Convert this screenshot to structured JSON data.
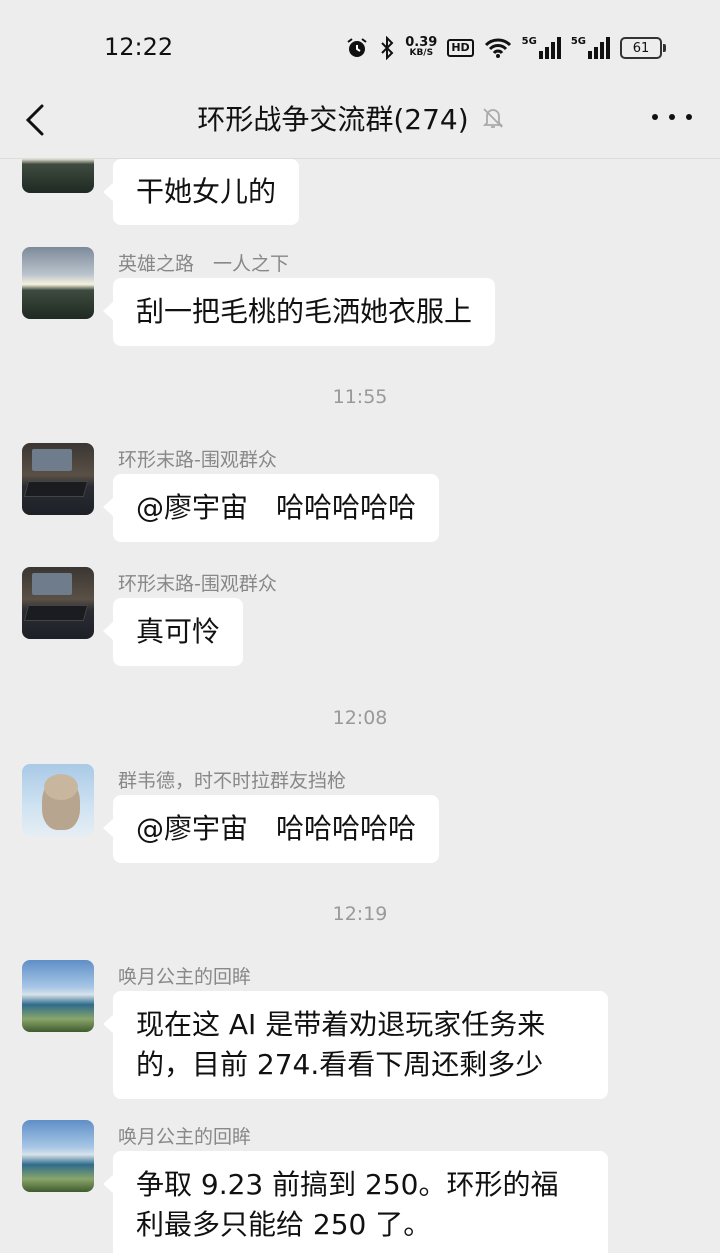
{
  "status_bar": {
    "time": "12:22",
    "net_speed_value": "0.39",
    "net_speed_unit": "KB/S",
    "hd": "HD",
    "sim1": "5G",
    "sim2": "5G",
    "battery": "61",
    "icons": [
      "alarm-icon",
      "bluetooth-icon",
      "hd-icon",
      "wifi-icon",
      "signal-icon",
      "signal-icon",
      "battery-icon"
    ]
  },
  "header": {
    "title": "环形战争交流群(274)",
    "back_icon": "chevron-left-icon",
    "mute_icon": "muted-bell-icon",
    "more_icon": "more-icon"
  },
  "messages": [
    {
      "sender": "",
      "text": "干她女儿的",
      "avatar": "sunset-sky"
    },
    {
      "sender": "英雄之路　一人之下",
      "text": "刮一把毛桃的毛洒她衣服上",
      "avatar": "sunset-sky"
    },
    {
      "time": "11:55"
    },
    {
      "sender": "环形末路-围观群众",
      "text": "@廖宇宙　哈哈哈哈哈",
      "avatar": "desk-keyboard"
    },
    {
      "sender": "环形末路-围观群众",
      "text": "真可怜",
      "avatar": "desk-keyboard"
    },
    {
      "time": "12:08"
    },
    {
      "sender": "群韦德，时不时拉群友挡枪",
      "text": "@廖宇宙　哈哈哈哈哈",
      "avatar": "toy-figure"
    },
    {
      "time": "12:19"
    },
    {
      "sender": "唤月公主的回眸",
      "text_lines": [
        "现在这 AI 是带着劝退玩家任务来",
        "的，目前 274.看看下周还剩多少"
      ],
      "avatar": "seaside-cliff"
    },
    {
      "sender": "唤月公主的回眸",
      "text_lines": [
        "争取 9.23 前搞到 250。环形的福",
        "利最多只能给 250 了。"
      ],
      "avatar": "seaside-cliff"
    }
  ]
}
